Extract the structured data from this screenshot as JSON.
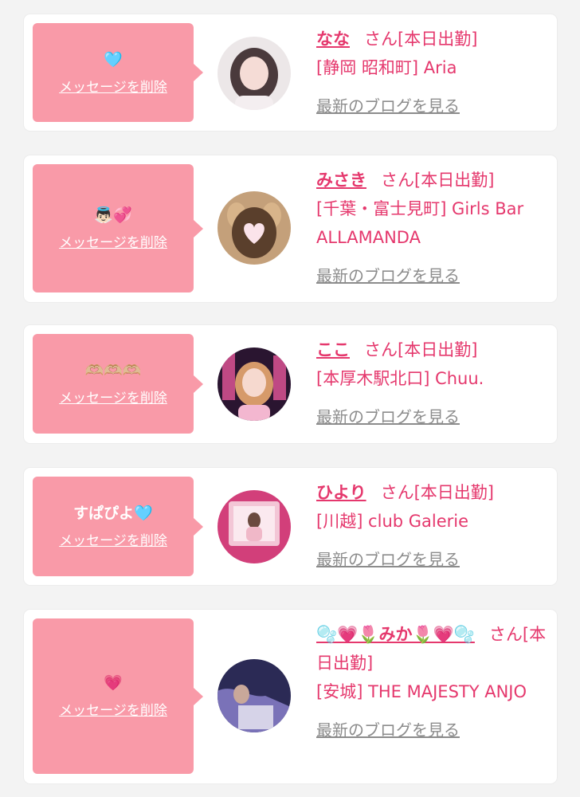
{
  "common": {
    "delete_label": "メッセージを削除",
    "san_label": "さん",
    "status_label": "[本日出勤]",
    "blog_label": "最新のブログを見る"
  },
  "colors": {
    "accent": "#e5386d",
    "bubble": "#f99aa8",
    "link_gray": "#8c8c8c"
  },
  "cards": [
    {
      "message": "🩵",
      "name": "なな",
      "shop": "[静岡 昭和町] Aria",
      "avatar_icon": "profile-photo-icon"
    },
    {
      "message": "👼🏻💞",
      "name": "みさき",
      "shop": "[千葉・富士見町] Girls Bar ALLAMANDA",
      "avatar_icon": "profile-photo-icon"
    },
    {
      "message": "🫶🏼🫶🏼🫶🏼",
      "name": "ここ",
      "shop": "[本厚木駅北口] Chuu.",
      "avatar_icon": "profile-photo-icon"
    },
    {
      "message": "すぱぴよ🩵",
      "name": "ひより",
      "shop": "[川越] club Galerie",
      "avatar_icon": "profile-photo-icon"
    },
    {
      "message": "💗",
      "name": "🫧💗🌷みか🌷💗🫧",
      "shop": "[安城] THE MAJESTY ANJO",
      "avatar_icon": "profile-photo-icon"
    }
  ]
}
